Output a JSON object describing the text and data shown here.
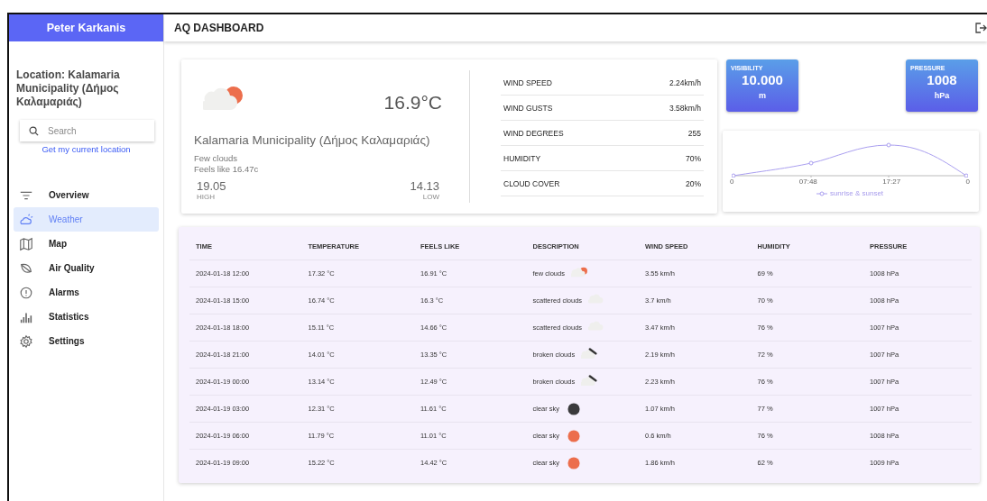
{
  "sidebar": {
    "user": "Peter Karkanis",
    "location": "Location: Kalamaria Municipality (Δήμος Καλαμαριάς)",
    "search": {
      "placeholder": "Search"
    },
    "location_link": "Get my current location",
    "items": [
      {
        "label": "Overview",
        "selected": false
      },
      {
        "label": "Weather",
        "selected": true
      },
      {
        "label": "Map",
        "selected": false
      },
      {
        "label": "Air Quality",
        "selected": false
      },
      {
        "label": "Alarms",
        "selected": false
      },
      {
        "label": "Statistics",
        "selected": false
      },
      {
        "label": "Settings",
        "selected": false
      }
    ]
  },
  "header": {
    "title": "AQ DASHBOARD"
  },
  "current": {
    "kind": "few-clouds",
    "temperature": "16.9°C",
    "place": "Kalamaria Municipality (Δήμος Καλαμαριάς)",
    "description": "Few clouds",
    "feels_like": "Feels like 16.47c",
    "high": "19.05",
    "high_label": "HIGH",
    "low": "14.13",
    "low_label": "LOW",
    "details": [
      {
        "label": "WIND SPEED",
        "value": "2.24km/h"
      },
      {
        "label": "WIND GUSTS",
        "value": "3.58km/h"
      },
      {
        "label": "WIND DEGREES",
        "value": "255"
      },
      {
        "label": "HUMIDITY",
        "value": "70%"
      },
      {
        "label": "CLOUD COVER",
        "value": "20%"
      }
    ]
  },
  "tiles": [
    {
      "label": "VISIBILITY",
      "value": "10.000",
      "unit": "m"
    },
    {
      "label": "PRESSURE",
      "value": "1008",
      "unit": "hPa"
    }
  ],
  "sun_chart": {
    "x_labels": [
      "0",
      "07:48",
      "17:27",
      "0"
    ],
    "legend": "sunrise & sunset"
  },
  "forecast": {
    "columns": [
      "TIME",
      "TEMPERATURE",
      "FEELS LIKE",
      "DESCRIPTION",
      "WIND SPEED",
      "HUMIDITY",
      "PRESSURE"
    ],
    "rows": [
      {
        "time": "2024-01-18 12:00",
        "temperature": "17.32 °C",
        "feels_like": "16.91 °C",
        "description": "few clouds",
        "kind": "few-clouds",
        "wind_speed": "3.55 km/h",
        "humidity": "69 %",
        "pressure": "1008 hPa"
      },
      {
        "time": "2024-01-18 15:00",
        "temperature": "16.74 °C",
        "feels_like": "16.3 °C",
        "description": "scattered clouds",
        "kind": "scattered-clouds",
        "wind_speed": "3.7 km/h",
        "humidity": "70 %",
        "pressure": "1008 hPa"
      },
      {
        "time": "2024-01-18 18:00",
        "temperature": "15.11 °C",
        "feels_like": "14.66 °C",
        "description": "scattered clouds",
        "kind": "scattered-clouds",
        "wind_speed": "3.47 km/h",
        "humidity": "76 %",
        "pressure": "1007 hPa"
      },
      {
        "time": "2024-01-18 21:00",
        "temperature": "14.01 °C",
        "feels_like": "13.35 °C",
        "description": "broken clouds",
        "kind": "broken-clouds",
        "wind_speed": "2.19 km/h",
        "humidity": "72 %",
        "pressure": "1007 hPa"
      },
      {
        "time": "2024-01-19 00:00",
        "temperature": "13.14 °C",
        "feels_like": "12.49 °C",
        "description": "broken clouds",
        "kind": "broken-clouds",
        "wind_speed": "2.23 km/h",
        "humidity": "76 %",
        "pressure": "1007 hPa"
      },
      {
        "time": "2024-01-19 03:00",
        "temperature": "12.31 °C",
        "feels_like": "11.61 °C",
        "description": "clear sky",
        "kind": "clear-night",
        "wind_speed": "1.07 km/h",
        "humidity": "77 %",
        "pressure": "1007 hPa"
      },
      {
        "time": "2024-01-19 06:00",
        "temperature": "11.79 °C",
        "feels_like": "11.01 °C",
        "description": "clear sky",
        "kind": "clear-day",
        "wind_speed": "0.6 km/h",
        "humidity": "76 %",
        "pressure": "1008 hPa"
      },
      {
        "time": "2024-01-19 09:00",
        "temperature": "15.22 °C",
        "feels_like": "14.42 °C",
        "description": "clear sky",
        "kind": "clear-day",
        "wind_speed": "1.86 km/h",
        "humidity": "62 %",
        "pressure": "1009 hPa"
      }
    ]
  }
}
